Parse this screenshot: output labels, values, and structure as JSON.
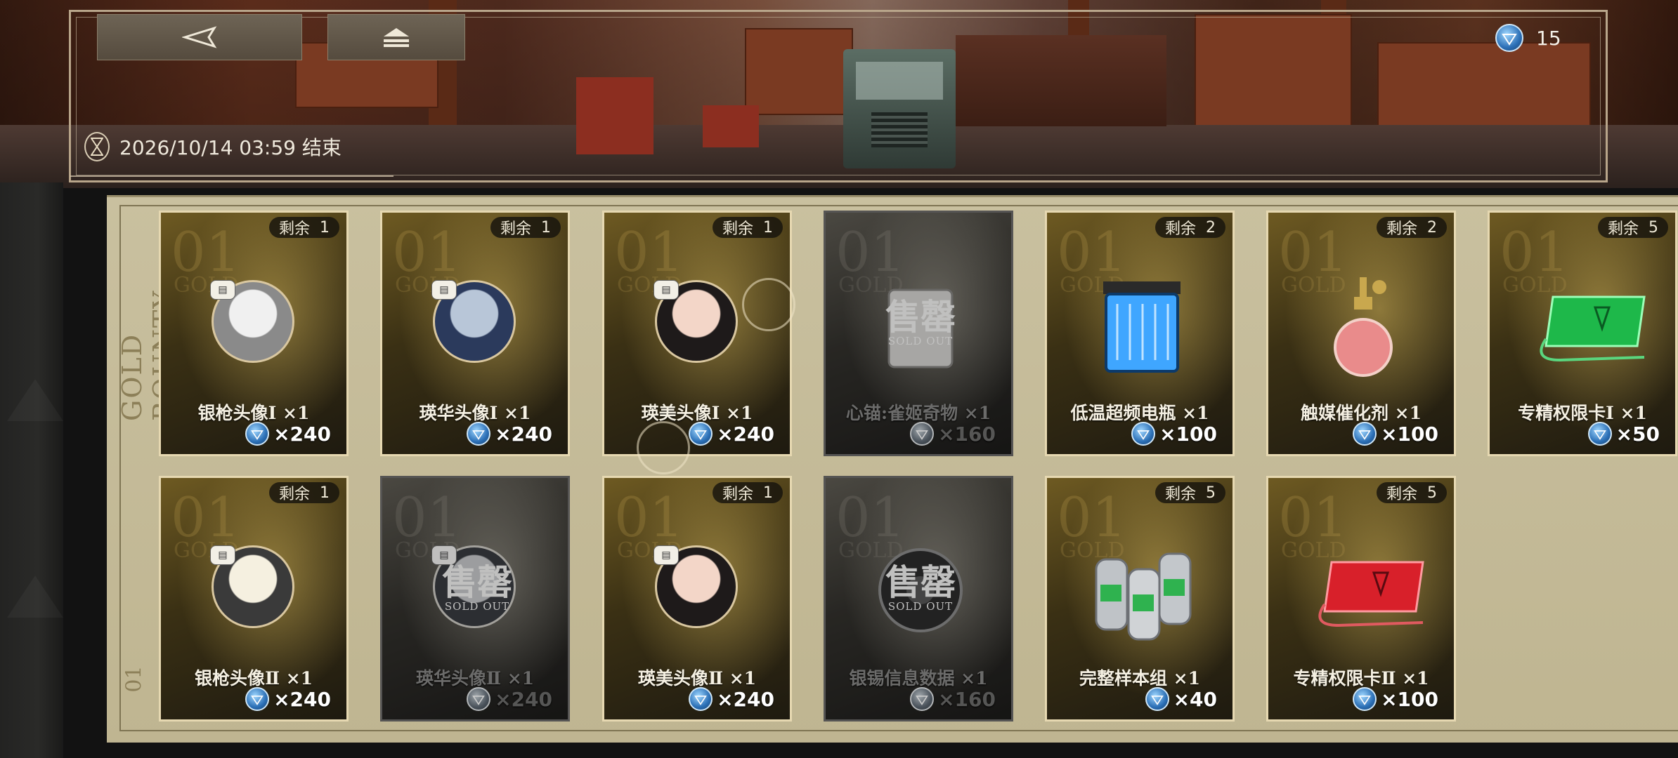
{
  "header": {
    "back_icon": "◁",
    "home_icon": "⏏",
    "currency_value": "15",
    "end_time": "2026/10/14 03:59 结束"
  },
  "panel": {
    "side_label": "GOLD BOUNTY",
    "side_number": "01"
  },
  "colors": {
    "gold_border": "#e6d8b1",
    "sold_border": "#6e6a64",
    "gem_blue": "#2b6fb6"
  },
  "cards": [
    {
      "stock_label": "剩余",
      "stock": "1",
      "name": "银枪头像Ⅰ ×1",
      "price": "×240",
      "soldout": false,
      "kind": "portrait"
    },
    {
      "stock_label": "剩余",
      "stock": "1",
      "name": "瑛华头像Ⅰ ×1",
      "price": "×240",
      "soldout": false,
      "kind": "portrait"
    },
    {
      "stock_label": "剩余",
      "stock": "1",
      "name": "瑛美头像Ⅰ ×1",
      "price": "×240",
      "soldout": false,
      "kind": "portrait"
    },
    {
      "stock_label": "",
      "stock": "",
      "name": "心锚:雀姬奇物 ×1",
      "price": "×160",
      "soldout": true,
      "kind": "item"
    },
    {
      "stock_label": "剩余",
      "stock": "2",
      "name": "低温超频电瓶 ×1",
      "price": "×100",
      "soldout": false,
      "kind": "item"
    },
    {
      "stock_label": "剩余",
      "stock": "2",
      "name": "触媒催化剂 ×1",
      "price": "×100",
      "soldout": false,
      "kind": "item"
    },
    {
      "stock_label": "剩余",
      "stock": "5",
      "name": "专精权限卡Ⅰ ×1",
      "price": "×50",
      "soldout": false,
      "kind": "item"
    },
    {
      "stock_label": "剩余",
      "stock": "1",
      "name": "银枪头像Ⅱ ×1",
      "price": "×240",
      "soldout": false,
      "kind": "portrait"
    },
    {
      "stock_label": "",
      "stock": "",
      "name": "瑛华头像Ⅱ ×1",
      "price": "×240",
      "soldout": true,
      "kind": "portrait"
    },
    {
      "stock_label": "剩余",
      "stock": "1",
      "name": "瑛美头像Ⅱ ×1",
      "price": "×240",
      "soldout": false,
      "kind": "portrait"
    },
    {
      "stock_label": "",
      "stock": "",
      "name": "银锡信息数据 ×1",
      "price": "×160",
      "soldout": true,
      "kind": "item"
    },
    {
      "stock_label": "剩余",
      "stock": "5",
      "name": "完整样本组 ×1",
      "price": "×40",
      "soldout": false,
      "kind": "item"
    },
    {
      "stock_label": "剩余",
      "stock": "5",
      "name": "专精权限卡Ⅱ ×1",
      "price": "×100",
      "soldout": false,
      "kind": "item"
    }
  ],
  "card_watermark": {
    "number": "01",
    "word": "GOLD"
  },
  "soldout_stamp": {
    "zh": "售罄",
    "en": "SOLD OUT"
  },
  "icons": {
    "currency": "blue-gem-icon",
    "timer": "hourglass-icon",
    "id_badge": "id-card-icon"
  }
}
